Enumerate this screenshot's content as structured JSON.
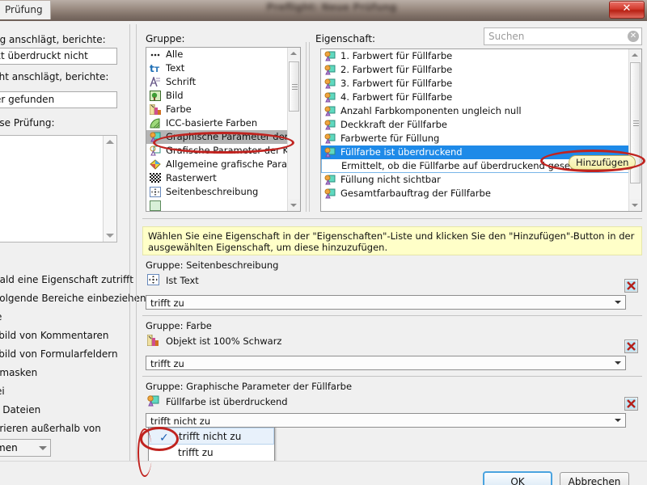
{
  "window": {
    "title_blurred": "Preflight: Neue Prüfung",
    "close_label": "✕",
    "tab_label": "Prüfung"
  },
  "left_panel": {
    "label_1": "ng anschlägt, berichte:",
    "input_1": "kt überdruckt nicht",
    "label_2": "cht anschlägt, berichte:",
    "input_2": "er gefunden",
    "label_3": "ese Prüfung:",
    "label_4": "bald eine Eigenschaft zutrifft",
    "label_5": "folgende Bereiche einbeziehen:",
    "label_6": "e",
    "label_7": "sbild von Kommentaren",
    "label_8": "sbild von Formularfeldern",
    "label_9": "emasken",
    "label_10": "ei",
    "label_11": "e Dateien",
    "label_12": "orieren außerhalb von",
    "combo_value": "men"
  },
  "group_panel": {
    "label": "Gruppe:",
    "items": [
      {
        "text": "Alle",
        "icon": "dots-icon",
        "selected": false
      },
      {
        "text": "Text",
        "icon": "text-icon",
        "selected": false
      },
      {
        "text": "Schrift",
        "icon": "font-icon",
        "selected": false
      },
      {
        "text": "Bild",
        "icon": "image-icon",
        "selected": false
      },
      {
        "text": "Farbe",
        "icon": "color-icon",
        "selected": false
      },
      {
        "text": "ICC-basierte Farben",
        "icon": "icc-color-icon",
        "selected": false
      },
      {
        "text": "Graphische Parameter der Füllf",
        "icon": "fill-params-icon",
        "selected": true
      },
      {
        "text": "Grafische Parameter der Kontu",
        "icon": "stroke-params-icon",
        "selected": false
      },
      {
        "text": "Allgemeine grafische Paramete",
        "icon": "general-graphic-icon",
        "selected": false
      },
      {
        "text": "Rasterwert",
        "icon": "halftone-icon",
        "selected": false
      },
      {
        "text": "Seitenbeschreibung",
        "icon": "page-desc-icon",
        "selected": false
      },
      {
        "text": "",
        "icon": "partial-icon",
        "selected": false
      }
    ]
  },
  "property_panel": {
    "label": "Eigenschaft:",
    "search_placeholder": "Suchen",
    "search_value": "",
    "clear_label": "✕",
    "add_button_label": "Hinzufügen",
    "items": [
      {
        "text": "1. Farbwert für Füllfarbe",
        "selected": false
      },
      {
        "text": "2. Farbwert für Füllfarbe",
        "selected": false
      },
      {
        "text": "3. Farbwert für Füllfarbe",
        "selected": false
      },
      {
        "text": "4. Farbwert für Füllfarbe",
        "selected": false
      },
      {
        "text": "Anzahl Farbkomponenten ungleich null",
        "selected": false
      },
      {
        "text": "Deckkraft der Füllfarbe",
        "selected": false
      },
      {
        "text": "Farbwerte für Füllung",
        "selected": false
      },
      {
        "text": "Füllfarbe ist überdruckend",
        "selected": true
      },
      {
        "text": "Füllung nicht sichtbar",
        "selected": false
      },
      {
        "text": "Gesamtfarbauftrag der Füllfarbe",
        "selected": false
      }
    ],
    "selected_description": "Ermittelt, ob die Füllfarbe auf überdruckend gesetzt ist."
  },
  "hint": {
    "text": "Wählen Sie eine Eigenschaft in der \"Eigenschaften\"-Liste und klicken Sie den \"Hinzufügen\"-Button in der ausgewählten Eigenschaft, um diese hinzuzufügen."
  },
  "conditions": [
    {
      "group_label": "Gruppe:  Seitenbeschreibung",
      "property": "Ist Text",
      "icon": "page-desc-icon",
      "operator": "trifft zu",
      "delete_label": "✕"
    },
    {
      "group_label": "Gruppe:  Farbe",
      "property": "Objekt ist 100% Schwarz",
      "icon": "color-icon",
      "operator": "trifft zu",
      "delete_label": "✕"
    },
    {
      "group_label": "Gruppe:  Graphische Parameter der Füllfarbe",
      "property": "Füllfarbe ist überdruckend",
      "icon": "fill-params-icon",
      "operator": "trifft nicht zu",
      "delete_label": "✕"
    }
  ],
  "dropdown": {
    "check_glyph": "✓",
    "options": [
      {
        "label": "trifft nicht zu",
        "checked": true
      },
      {
        "label": "trifft zu",
        "checked": false
      }
    ]
  },
  "footer": {
    "ok_label": "OK",
    "cancel_label": "Abbrechen"
  },
  "colors": {
    "selection_blue": "#1e8ae8",
    "selection_gray": "#b4b4b4",
    "hint_yellow": "#ffffc8",
    "annotation_red": "#c0231f",
    "add_button_yellow": "#f7f2ab"
  }
}
